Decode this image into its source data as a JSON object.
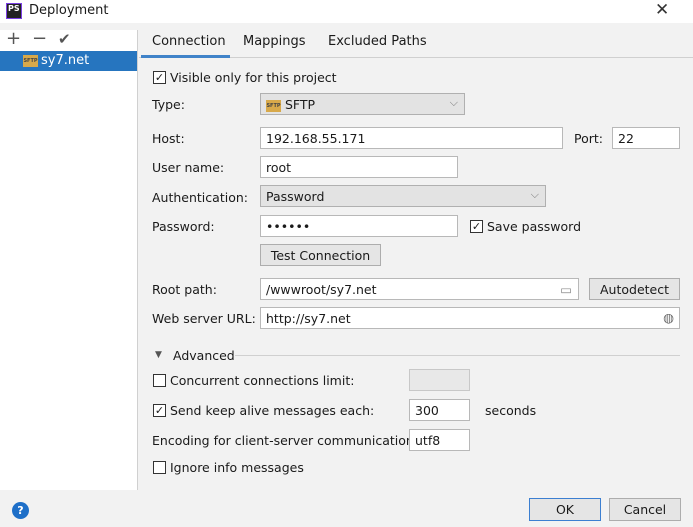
{
  "window": {
    "title": "Deployment",
    "app_icon": "PS"
  },
  "sidebar": {
    "toolbar": {
      "add": "+",
      "remove": "−",
      "apply": "✔"
    },
    "items": [
      {
        "label": "sy7.net",
        "icon": "SFTP",
        "selected": true
      }
    ]
  },
  "tabs": [
    {
      "label": "Connection",
      "active": true
    },
    {
      "label": "Mappings"
    },
    {
      "label": "Excluded Paths"
    }
  ],
  "connection": {
    "visible_only": {
      "label": "Visible only for this project",
      "checked": true
    },
    "type": {
      "label": "Type:",
      "value": "SFTP",
      "icon": "SFTP"
    },
    "host": {
      "label": "Host:",
      "value": "192.168.55.171"
    },
    "port": {
      "label": "Port:",
      "value": "22"
    },
    "username": {
      "label": "User name:",
      "value": "root"
    },
    "auth": {
      "label": "Authentication:",
      "value": "Password"
    },
    "password": {
      "label": "Password:",
      "value": "••••••"
    },
    "save_password": {
      "label": "Save password",
      "checked": true
    },
    "test_connection": "Test Connection",
    "root_path": {
      "label": "Root path:",
      "value": "/wwwroot/sy7.net"
    },
    "autodetect": "Autodetect",
    "web_url": {
      "label": "Web server URL:",
      "value": "http://sy7.net"
    }
  },
  "advanced": {
    "title": "Advanced",
    "concurrent": {
      "label": "Concurrent connections limit:",
      "checked": false,
      "value": ""
    },
    "keepalive": {
      "label": "Send keep alive messages each:",
      "checked": true,
      "value": "300",
      "unit": "seconds"
    },
    "encoding": {
      "label": "Encoding for client-server communication:",
      "value": "utf8"
    },
    "ignore_info": {
      "label": "Ignore info messages",
      "checked": false
    }
  },
  "footer": {
    "help": "?",
    "ok": "OK",
    "cancel": "Cancel"
  },
  "colors": {
    "selection": "#2675bf",
    "tab_underline": "#4083c9",
    "help": "#1e6fc8"
  }
}
